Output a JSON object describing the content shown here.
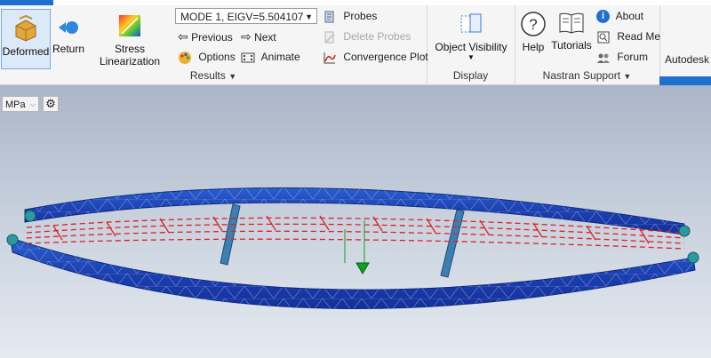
{
  "ribbon": {
    "results_panel": {
      "title": "Results",
      "deformed_label": "Deformed",
      "return_label": "Return",
      "stress_label": "Stress Linearization",
      "mode_select": "MODE 1, EIGV=5.504107",
      "previous_label": "Previous",
      "next_label": "Next",
      "options_label": "Options",
      "animate_label": "Animate",
      "probes_label": "Probes",
      "delete_probes_label": "Delete Probes",
      "convergence_label": "Convergence Plot"
    },
    "display_panel": {
      "title": "Display",
      "object_visibility_label": "Object Visibility"
    },
    "nastran_panel": {
      "title": "Nastran Support",
      "help_label": "Help",
      "tutorials_label": "Tutorials",
      "about_label": "About",
      "readme_label": "Read Me",
      "forum_label": "Forum"
    },
    "autodesk_label": "Autodesk I"
  },
  "viewport": {
    "units": "MPa"
  },
  "colors": {
    "accent": "#1f6fd0",
    "mesh_blue": "#1c3fb0",
    "load_red": "#e02020",
    "constraint_green": "#10a020"
  }
}
